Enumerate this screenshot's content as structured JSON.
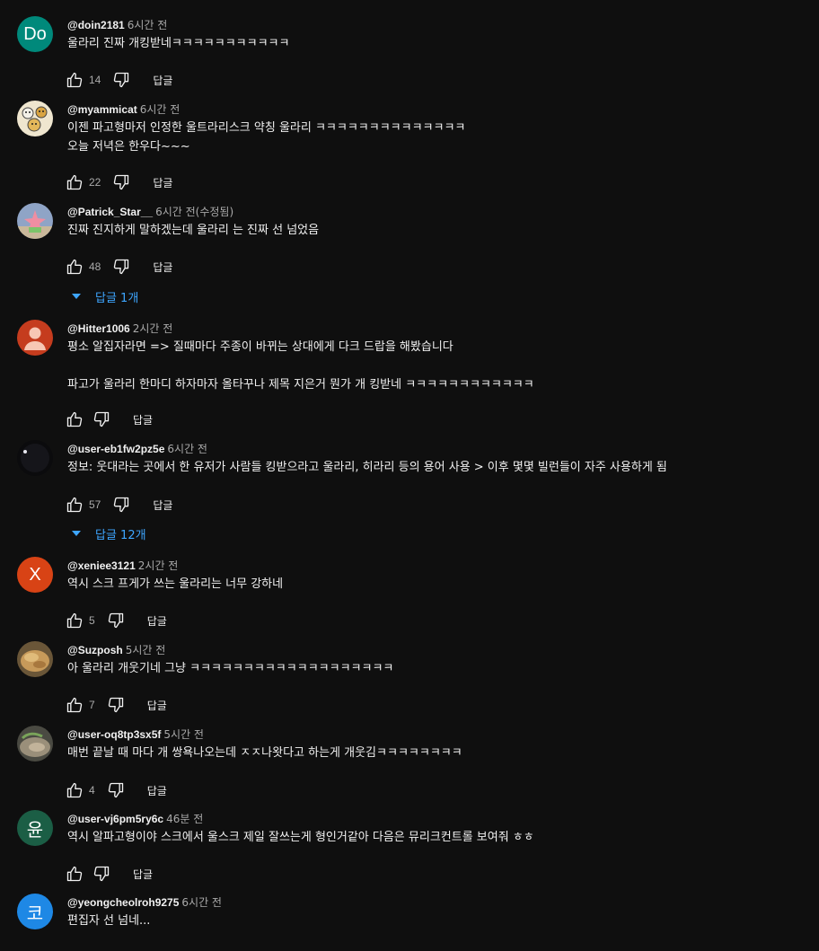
{
  "comments": [
    {
      "author": "@doin2181",
      "time": "6시간 전",
      "lines": [
        "울라리 진짜 개킹받네ㅋㅋㅋㅋㅋㅋㅋㅋㅋㅋㅋ"
      ],
      "likes": "14",
      "reply_label": "답글",
      "avatar": {
        "type": "letter",
        "letter": "Do",
        "color": "#00897b"
      }
    },
    {
      "author": "@myammicat",
      "time": "6시간 전",
      "lines": [
        "이젠 파고형마저 인정한 울트라리스크 약칭 울라리 ㅋㅋㅋㅋㅋㅋㅋㅋㅋㅋㅋㅋㅋㅋ",
        "오늘 저녁은 한우다~~~"
      ],
      "likes": "22",
      "reply_label": "답글",
      "avatar": {
        "type": "cats-icon"
      }
    },
    {
      "author": "@Patrick_Star__",
      "time": "6시간 전(수정됨)",
      "lines": [
        "진짜 진지하게 말하겠는데 울라리 는 진짜 선 넘었음"
      ],
      "likes": "48",
      "reply_label": "답글",
      "replies_label": "답글 1개",
      "avatar": {
        "type": "starfish-icon"
      }
    },
    {
      "author": "@Hitter1006",
      "time": "2시간 전",
      "lines": [
        "평소 알집자라면 => 질때마다 주종이 바뀌는 상대에게 다크 드랍을 해봤습니다",
        "",
        "파고가 울라리 한마디 하자마자 올타꾸나 제목 지은거 뭔가 개 킹받네 ㅋㅋㅋㅋㅋㅋㅋㅋㅋㅋㅋㅋ"
      ],
      "likes": "",
      "reply_label": "답글",
      "avatar": {
        "type": "person-icon",
        "color": "#c53c1e"
      }
    },
    {
      "author": "@user-eb1fw2pz5e",
      "time": "6시간 전",
      "lines": [
        "정보: 웃대라는 곳에서 한 유저가 사람들 킹받으라고 울라리, 히라리 등의 용어 사용 > 이후 몇몇 빌런들이 자주 사용하게 됨"
      ],
      "likes": "57",
      "reply_label": "답글",
      "replies_label": "답글 12개",
      "avatar": {
        "type": "dark-orb-icon"
      }
    },
    {
      "author": "@xeniee3121",
      "time": "2시간 전",
      "lines": [
        "역시 스크 프게가 쓰는 울라리는 너무 강하네"
      ],
      "likes": "5",
      "reply_label": "답글",
      "avatar": {
        "type": "letter",
        "letter": "X",
        "color": "#d84315"
      }
    },
    {
      "author": "@Suzposh",
      "time": "5시간 전",
      "lines": [
        "아 울라리 개웃기네 그냥 ㅋㅋㅋㅋㅋㅋㅋㅋㅋㅋㅋㅋㅋㅋㅋㅋㅋㅋㅋ"
      ],
      "likes": "7",
      "reply_label": "답글",
      "avatar": {
        "type": "food-icon"
      }
    },
    {
      "author": "@user-oq8tp3sx5f",
      "time": "5시간 전",
      "lines": [
        "매번 끝날 때 마다 개 쌍욕나오는데 ㅈㅈ나왓다고 하는게 개웃김ㅋㅋㅋㅋㅋㅋㅋㅋ"
      ],
      "likes": "4",
      "reply_label": "답글",
      "avatar": {
        "type": "dish-icon"
      }
    },
    {
      "author": "@user-vj6pm5ry6c",
      "time": "46분 전",
      "lines": [
        "역시 알파고형이야 스크에서 울스크 제일 잘쓰는게 형인거같아 다음은 뮤리크컨트롤 보여줘 ㅎㅎ"
      ],
      "likes": "",
      "reply_label": "답글",
      "avatar": {
        "type": "letter",
        "letter": "윤",
        "color": "#1b5e45"
      }
    },
    {
      "author": "@yeongcheolroh9275",
      "time": "6시간 전",
      "lines": [
        "편집자 선 넘네..."
      ],
      "likes": "",
      "reply_label": "",
      "avatar": {
        "type": "letter",
        "letter": "코",
        "color": "#1e88e5"
      }
    }
  ]
}
